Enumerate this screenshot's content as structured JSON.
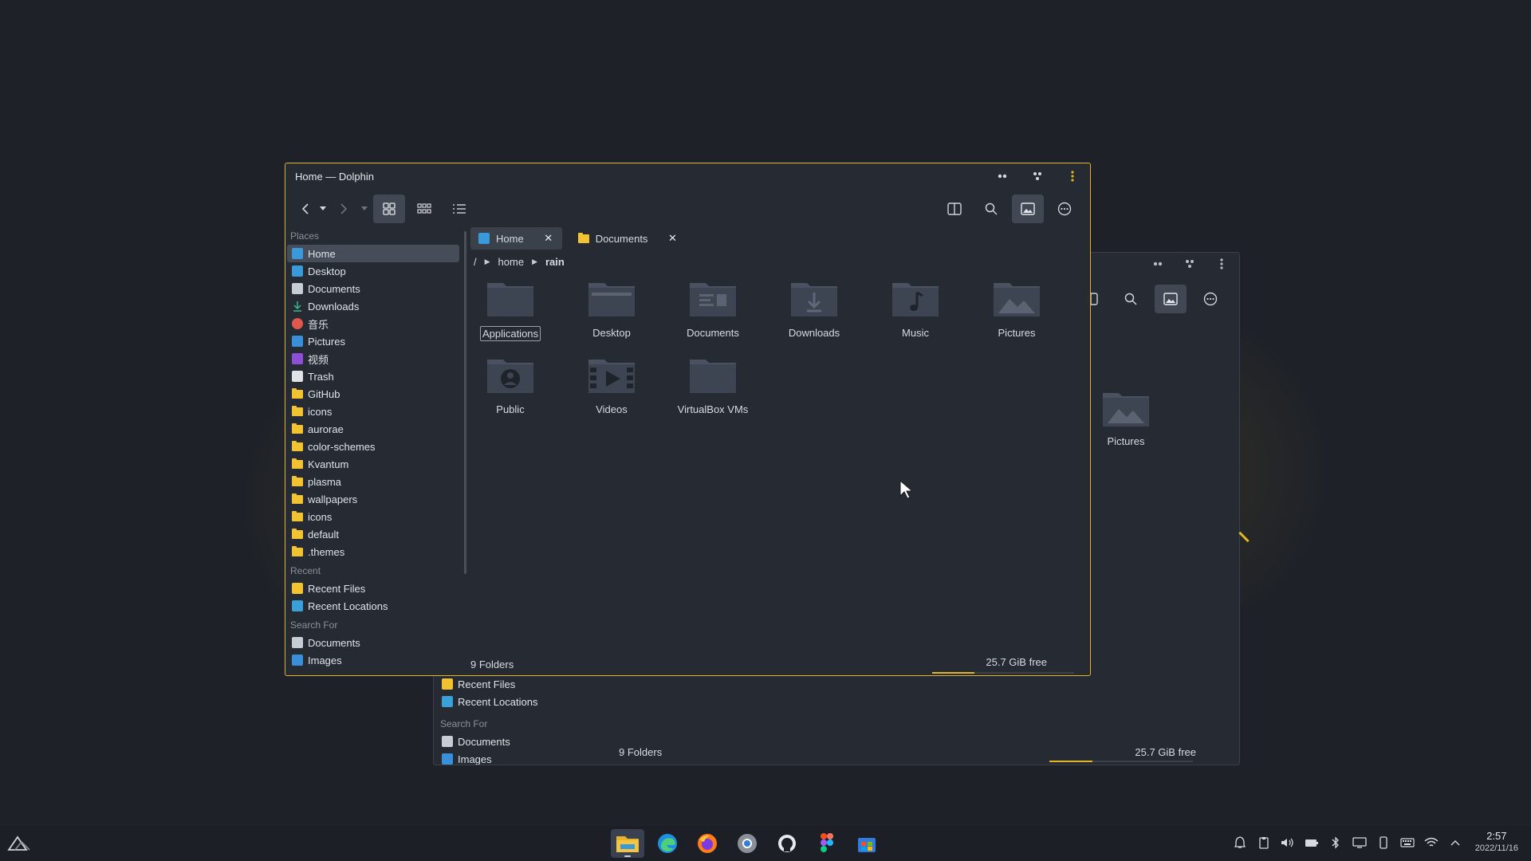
{
  "main_window": {
    "title": "Home — Dolphin",
    "sidebar": {
      "places_header": "Places",
      "places": [
        "Home",
        "Desktop",
        "Documents",
        "Downloads",
        "音乐",
        "Pictures",
        "视频",
        "Trash",
        "GitHub",
        "icons",
        "aurorae",
        "color-schemes",
        "Kvantum",
        "plasma",
        "wallpapers",
        "icons",
        "default",
        ".themes"
      ],
      "recent_header": "Recent",
      "recent": [
        "Recent Files",
        "Recent Locations"
      ],
      "search_header": "Search For",
      "search": [
        "Documents",
        "Images"
      ]
    },
    "tabs": [
      "Home",
      "Documents"
    ],
    "breadcrumb": {
      "root": "/",
      "parts": [
        "home",
        "rain"
      ]
    },
    "folders": [
      "Applications",
      "Desktop",
      "Documents",
      "Downloads",
      "Music",
      "Pictures",
      "Public",
      "Videos",
      "VirtualBox VMs"
    ],
    "status": "9 Folders",
    "free_space": "25.7 GiB free",
    "free_fraction": 0.3
  },
  "back_window": {
    "visible_folder": "Pictures",
    "recent": [
      "Recent Files",
      "Recent Locations"
    ],
    "search_header": "Search For",
    "search": [
      "Documents",
      "Images"
    ],
    "status": "9 Folders",
    "free_space": "25.7 GiB free"
  },
  "taskbar": {
    "apps": [
      "file-manager",
      "edge-browser",
      "firefox",
      "chromium",
      "github-desktop",
      "figma",
      "store"
    ],
    "time": "2:57",
    "date": "2022/11/16"
  },
  "colors": {
    "accent": "#e0b626",
    "folder": "#3d4452",
    "window_bg": "#262b33"
  }
}
